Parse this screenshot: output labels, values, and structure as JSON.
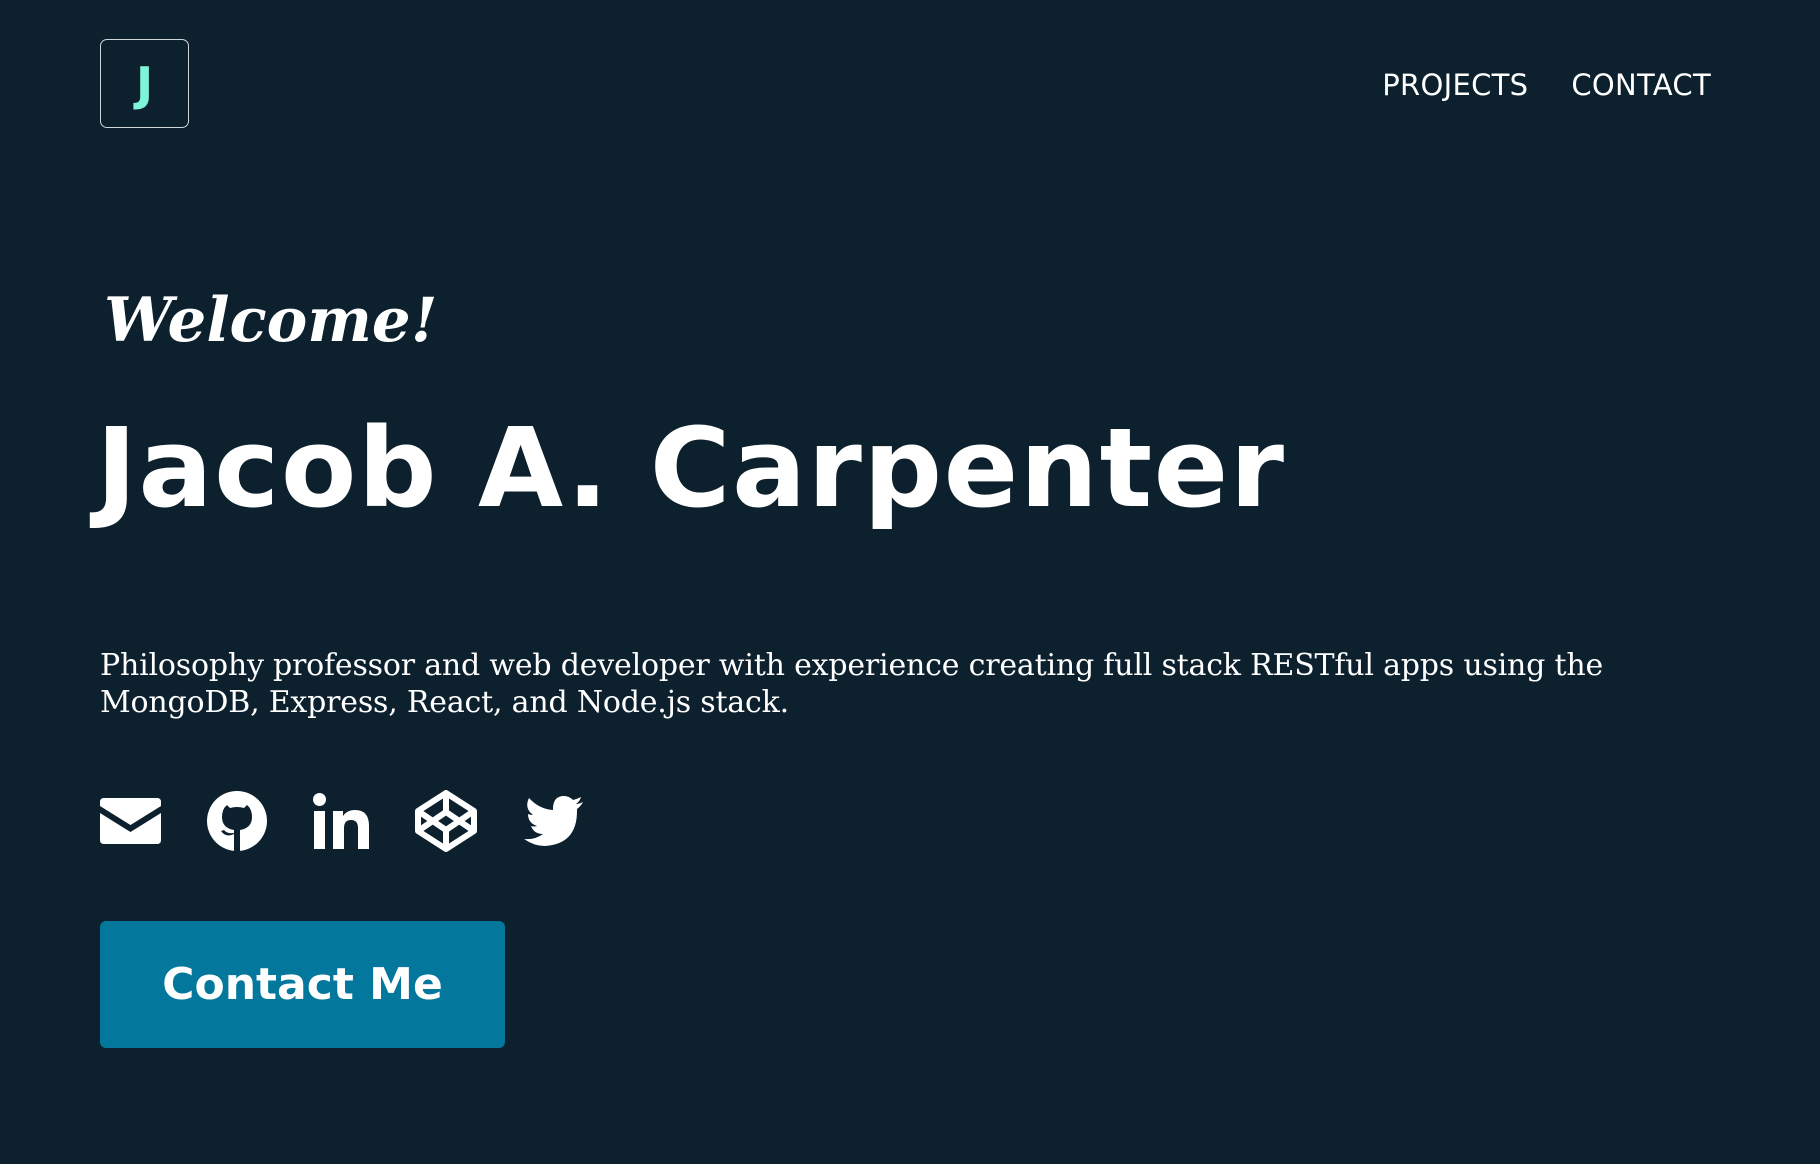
{
  "header": {
    "logo_text": "J",
    "nav": [
      {
        "label": "PROJECTS"
      },
      {
        "label": "CONTACT"
      }
    ]
  },
  "hero": {
    "greeting": "Welcome!",
    "name": "Jacob A. Carpenter",
    "bio": "Philosophy professor and web developer with experience creating full stack RESTful apps using the MongoDB, Express, React, and Node.js stack.",
    "social_icons": [
      "envelope-icon",
      "github-icon",
      "linkedin-icon",
      "codepen-icon",
      "twitter-icon"
    ],
    "cta_label": "Contact Me"
  },
  "colors": {
    "background": "#0c202d",
    "text": "#ffffff",
    "logo_accent": "#7ef5d9",
    "button": "#03779c"
  }
}
